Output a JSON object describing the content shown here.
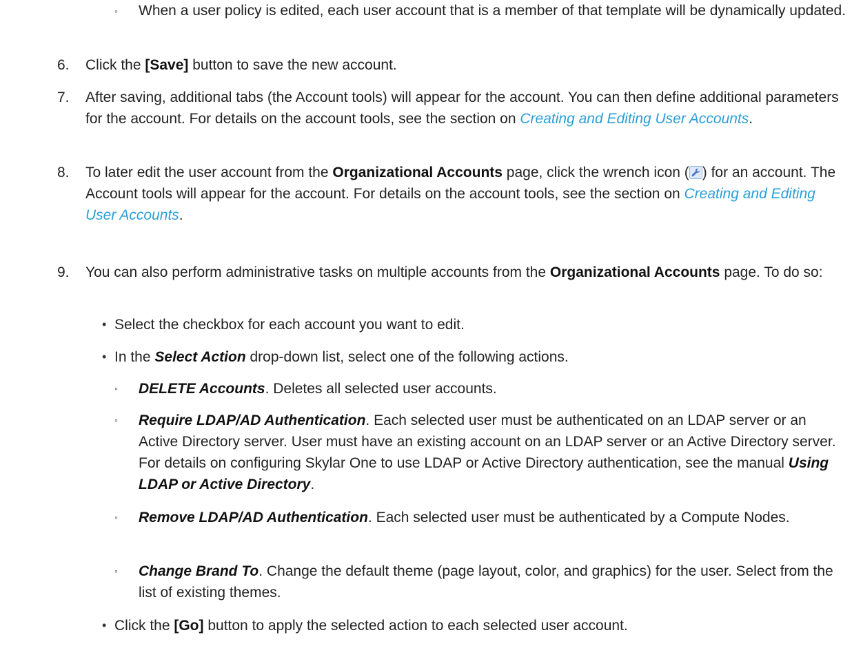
{
  "intro_sub": {
    "marker": "◦",
    "text": "When a user policy is edited, each user account that is a member of that template will be dynamically updated."
  },
  "step6": {
    "num": "6.",
    "pre": "Click the ",
    "bold": "[Save]",
    "post": " button to save the new account."
  },
  "step7": {
    "num": "7.",
    "text": "After saving, additional tabs (the Account tools) will appear for the account. You can then define additional parameters for the account. For details on the account tools, see the section on ",
    "link": "Creating and Editing User Accounts",
    "end": "."
  },
  "step8": {
    "num": "8.",
    "pre": "To later edit the user account from the ",
    "bold": "Organizational Accounts",
    "mid": " page, click the wrench icon (",
    "mid2": ") for an account. The Account tools will appear for the account. For details on the account tools, see the section on ",
    "link": "Creating and Editing User Accounts",
    "end": "."
  },
  "step9": {
    "num": "9.",
    "pre": "You can also perform administrative tasks on multiple accounts from the ",
    "bold": "Organizational Accounts",
    "post": " page. To do so:",
    "bullets": {
      "marker": "•",
      "b1": "Select the checkbox for each account you want to edit.",
      "b2_pre": "In the ",
      "b2_em": "Select Action",
      "b2_post": " drop-down list, select one of the following actions.",
      "b3_pre": "Click the ",
      "b3_bold": "[Go]",
      "b3_post": " button to apply the selected action to each selected user account."
    },
    "actions": {
      "marker": "◦",
      "a1_em": "DELETE Accounts",
      "a1_text": ". Deletes all selected user accounts.",
      "a2_em": "Require LDAP/AD Authentication",
      "a2_text": ". Each selected user must be authenticated on an LDAP server or an Active Directory server. User must have an existing account on an LDAP server or an Active Directory server. For details on configuring Skylar One to use LDAP or Active Directory authentication, see the manual ",
      "a2_em2": "Using LDAP or Active Directory",
      "a2_end": ".",
      "a3_em": "Remove LDAP/AD Authentication",
      "a3_text": ". Each selected user must be authenticated by a Compute Nodes.",
      "a4_em": "Change Brand To",
      "a4_text": ". Change the default theme (page layout, color, and graphics) for the user. Select from the list of existing themes."
    }
  }
}
